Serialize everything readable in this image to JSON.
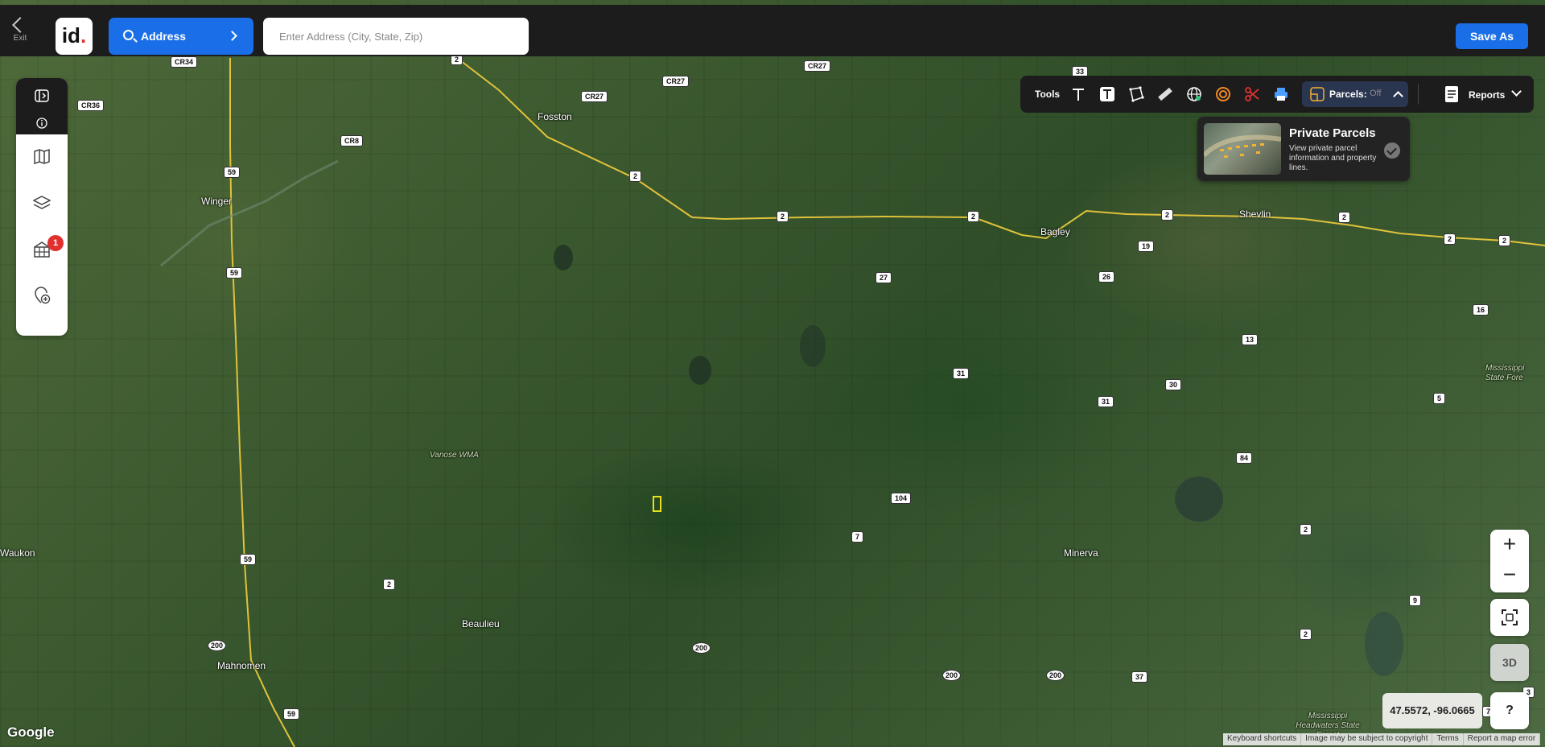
{
  "topbar": {
    "exit_label": "Exit",
    "logo_text": "id",
    "logo_dot": ".",
    "address_button_label": "Address",
    "address_placeholder": "Enter Address (City, State, Zip)",
    "save_as_label": "Save As"
  },
  "left_toolbar": {
    "badge_count": "1",
    "items": [
      "panel-toggle-icon",
      "info-icon",
      "map-icon",
      "layers-icon",
      "buildings-icon",
      "add-location-icon"
    ]
  },
  "tools_bar": {
    "label": "Tools",
    "icons": [
      "text-icon",
      "text-box-icon",
      "polygon-icon",
      "ruler-icon",
      "globe-icon",
      "radius-icon",
      "scissors-icon",
      "print-icon"
    ],
    "parcels_label": "Parcels:",
    "parcels_state": "Off",
    "reports_label": "Reports"
  },
  "parcels_card": {
    "title": "Private Parcels",
    "description": "View private parcel information and property lines."
  },
  "map_controls": {
    "zoom_in": "+",
    "zoom_out": "−",
    "three_d": "3D",
    "help": "?",
    "coordinates": "47.5572, -96.0665"
  },
  "map_labels": {
    "towns": [
      "Fosston",
      "Winger",
      "Bagley",
      "Shevlin",
      "Minerva",
      "Beaulieu",
      "Mahnomen",
      "Waukon"
    ],
    "areas": [
      "Vanose WMA",
      "Mississippi State Fore",
      "Mississippi Headwaters State Forest"
    ],
    "county_roads": [
      "CR34",
      "CR36",
      "CR8",
      "CR27",
      "CR27",
      "CR27"
    ],
    "route_numbers": [
      "2",
      "2",
      "2",
      "2",
      "2",
      "2",
      "2",
      "2",
      "59",
      "59",
      "59",
      "59",
      "200",
      "200",
      "200",
      "200",
      "27",
      "26",
      "19",
      "13",
      "16",
      "31",
      "31",
      "30",
      "5",
      "84",
      "104",
      "7",
      "2",
      "2",
      "2",
      "9",
      "37",
      "33",
      "3",
      "7"
    ]
  },
  "attribution": {
    "google": "Google",
    "links": [
      "Keyboard shortcuts",
      "Image may be subject to copyright",
      "Terms",
      "Report a map error"
    ]
  },
  "colors": {
    "accent": "#1a6fe8",
    "toolbar_bg": "#1c1c1c",
    "badge": "#e0312e",
    "highway": "#e0c23a"
  }
}
